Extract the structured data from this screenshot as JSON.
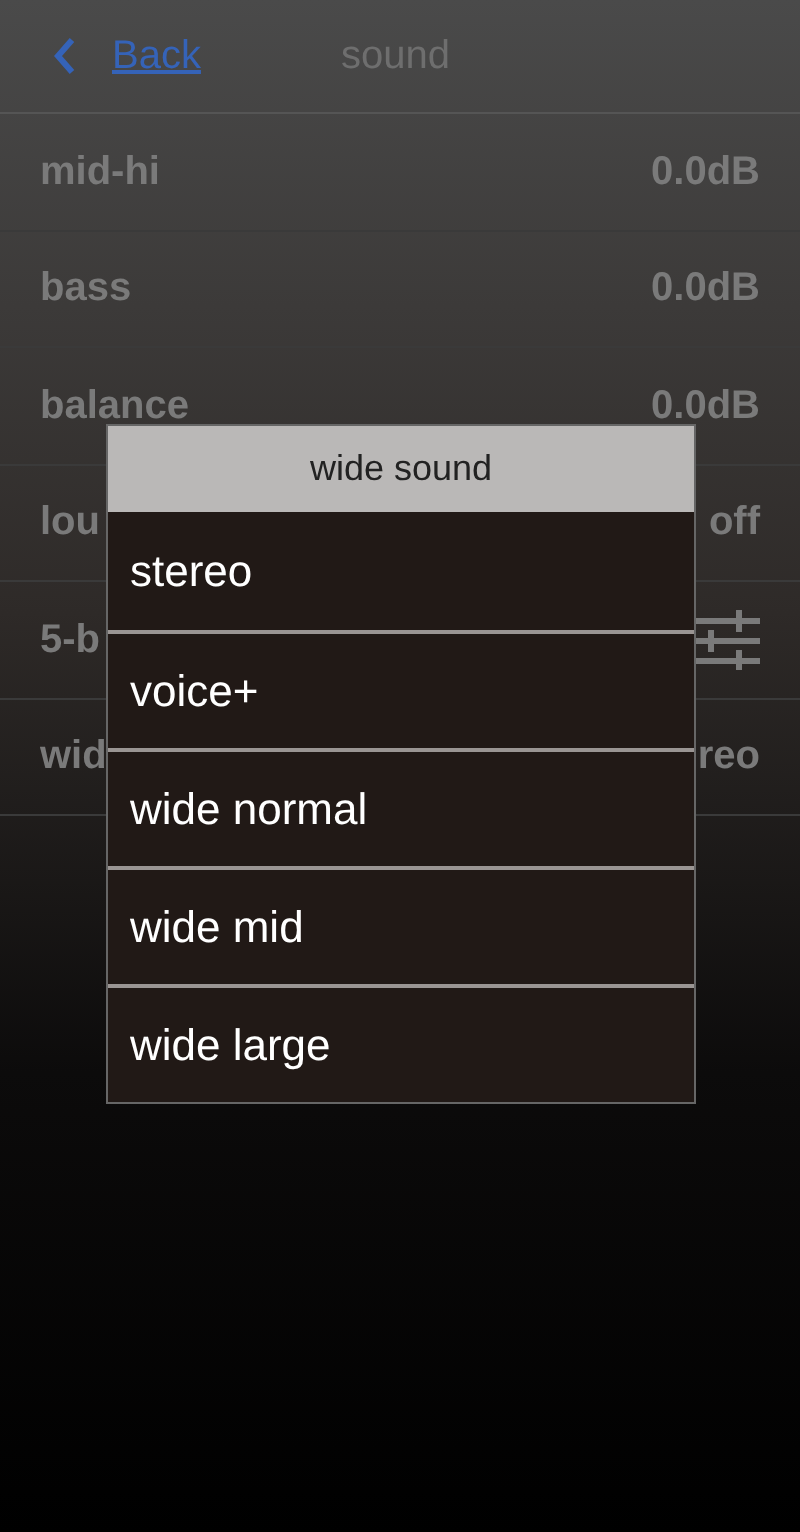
{
  "header": {
    "back": "Back",
    "title": "sound"
  },
  "rows": [
    {
      "kind": "value",
      "label": "mid-hi",
      "value": "0.0dB"
    },
    {
      "kind": "value",
      "label": "bass",
      "value": "0.0dB"
    },
    {
      "kind": "value",
      "label": "balance",
      "value": "0.0dB"
    },
    {
      "kind": "value",
      "label": "lou",
      "value": "off"
    },
    {
      "kind": "icon",
      "label": "5-b"
    },
    {
      "kind": "value",
      "label": "wid",
      "value": "reo"
    }
  ],
  "dialog": {
    "title": "wide sound",
    "options": [
      "stereo",
      "voice+",
      "wide normal",
      "wide mid",
      "wide large"
    ]
  }
}
